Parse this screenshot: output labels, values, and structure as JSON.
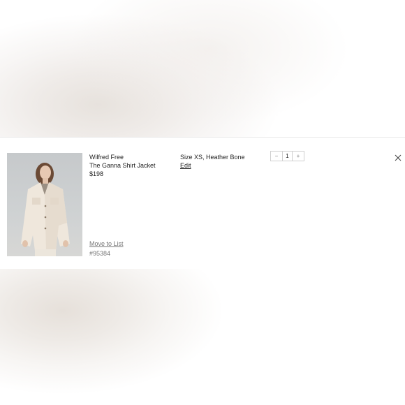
{
  "cart_item": {
    "brand": "Wilfred Free",
    "name": "The Ganna Shirt Jacket",
    "price": "$198",
    "variant": "Size XS, Heather Bone",
    "edit_label": "Edit",
    "quantity": "1",
    "decrement_symbol": "−",
    "increment_symbol": "+",
    "move_label": "Move to List",
    "sku": "#95384",
    "image_icon": "product-photo",
    "close_icon": "close-icon"
  }
}
